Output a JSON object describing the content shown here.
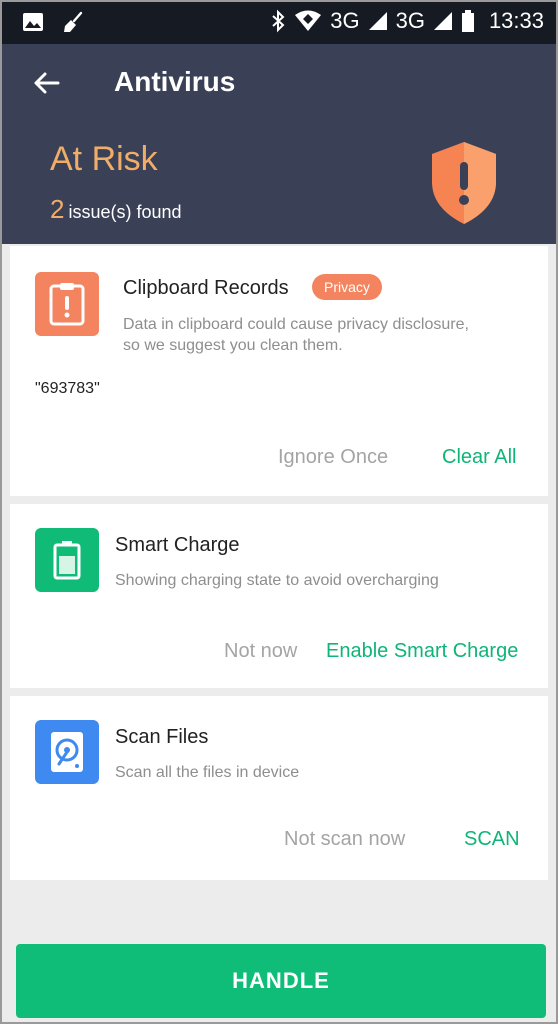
{
  "status_bar": {
    "network_1": "3G",
    "network_2": "3G",
    "time": "13:33"
  },
  "header": {
    "title": "Antivirus",
    "status": "At Risk",
    "issue_count": "2",
    "issue_text": "issue(s) found"
  },
  "cards": [
    {
      "title": "Clipboard Records",
      "badge": "Privacy",
      "description_line1": "Data in clipboard could cause privacy disclosure,",
      "description_line2": "so we suggest you clean them.",
      "value": "\"693783\"",
      "secondary_action": "Ignore Once",
      "primary_action": "Clear All",
      "icon": "clipboard-alert-icon"
    },
    {
      "title": "Smart Charge",
      "description": "Showing charging state to avoid overcharging",
      "secondary_action": "Not now",
      "primary_action": "Enable Smart Charge",
      "icon": "battery-icon"
    },
    {
      "title": "Scan Files",
      "description": "Scan all the files in device",
      "secondary_action": "Not scan now",
      "primary_action": "SCAN",
      "icon": "hard-drive-icon"
    }
  ],
  "handle_button": "HANDLE",
  "colors": {
    "header_bg": "#3a4157",
    "risk_orange": "#f0ad6a",
    "accent_green": "#0fbd79",
    "badge_orange": "#f3845f",
    "smart_charge_green": "#10bb78",
    "scan_blue": "#3e8af0"
  }
}
